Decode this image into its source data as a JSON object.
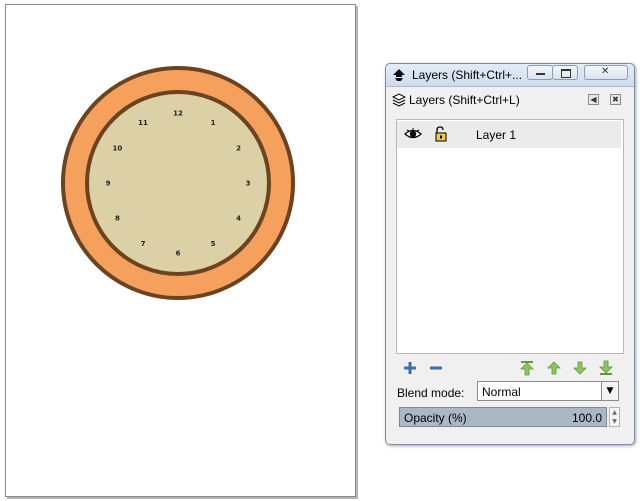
{
  "canvas": {
    "clock": {
      "outer_ring_color": "#f6a05e",
      "outline_color": "#6b431f",
      "face_color": "#dcd0a6",
      "numbers": [
        "12",
        "1",
        "2",
        "3",
        "4",
        "5",
        "6",
        "7",
        "8",
        "9",
        "10",
        "11"
      ]
    }
  },
  "dialog": {
    "title": "Layers (Shift+Ctrl+...",
    "dock_title": "Layers (Shift+Ctrl+L)",
    "window_buttons": {
      "minimize": "minimize-icon",
      "maximize": "maximize-icon",
      "close": "close-icon"
    },
    "layers": [
      {
        "name": "Layer 1",
        "visible_icon": "eye-icon",
        "lock_icon": "unlocked-padlock-icon"
      }
    ],
    "toolbar": {
      "add": "plus-icon",
      "remove": "minus-icon",
      "raise_to_top": "raise-to-top-icon",
      "raise": "raise-icon",
      "lower": "lower-icon",
      "lower_to_bottom": "lower-to-bottom-icon"
    },
    "blend_mode": {
      "label": "Blend mode:",
      "value": "Normal"
    },
    "opacity": {
      "label": "Opacity (%)",
      "value": "100.0"
    }
  }
}
